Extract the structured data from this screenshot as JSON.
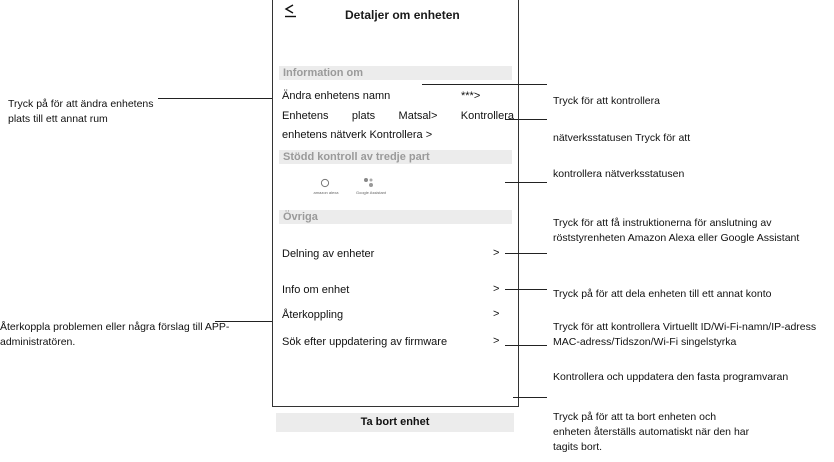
{
  "header": {
    "back_icon": "back-arrow-icon",
    "title": "Detaljer om enheten"
  },
  "sections": {
    "info_header": "Information om",
    "third_party_header": "Stödd kontroll av tredje part",
    "other_header": "Övriga"
  },
  "info": {
    "rename_label": "Ändra enhetens namn",
    "rename_value": "***>",
    "location_line": "Enhetens plats Matsal> Kontrollera",
    "network_line": "enhetens nätverk Kontrollera >"
  },
  "third_party": {
    "alexa_label": "amazon alexa",
    "google_label": "Google Assistant",
    "alexa_icon": "alexa-ring-icon",
    "google_icon": "google-assistant-icon"
  },
  "other_items": [
    {
      "label": "Delning av enheter",
      "chevron": ">"
    },
    {
      "label": "Info om enhet",
      "chevron": ">"
    },
    {
      "label": "Återkoppling",
      "chevron": ">"
    },
    {
      "label": "Sök efter uppdatering av firmware",
      "chevron": ">"
    }
  ],
  "remove_button": "Ta bort enhet",
  "annotations_left": {
    "location": "Tryck på för att ändra enhetens plats till ett annat rum",
    "feedback": "Återkoppla problemen eller några förslag till APP-administratören."
  },
  "annotations_right": {
    "rename": "Tryck för att kontrollera",
    "network": "nätverksstatusen Tryck för att",
    "network2": "kontrollera nätverksstatusen",
    "third_party": "Tryck för att få instruktionerna för anslutning av röststyrenheten Amazon Alexa eller Google Assistant",
    "share": "Tryck på för att dela enheten till ett annat konto",
    "info": "Tryck för att kontrollera Virtuellt ID/Wi-Fi-namn/IP-adress MAC-adress/Tidszon/Wi-Fi singelstyrka",
    "firmware": "Kontrollera och uppdatera den fasta programvaran",
    "remove": "Tryck på för att ta bort enheten och enheten återställs automatiskt när den har tagits bort."
  }
}
